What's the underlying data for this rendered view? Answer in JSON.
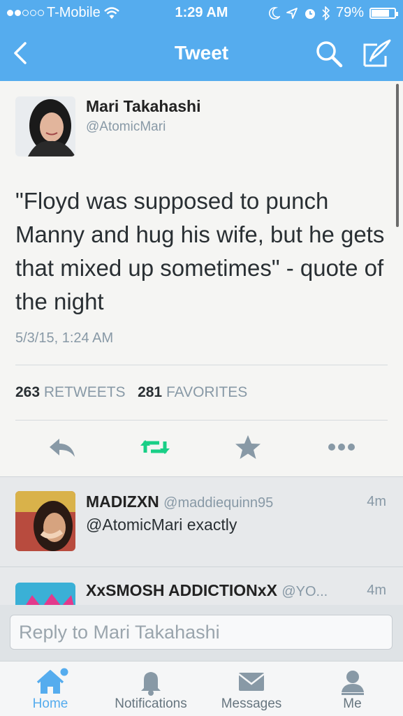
{
  "status_bar": {
    "carrier": "T-Mobile",
    "time": "1:29 AM",
    "battery": "79%",
    "battery_level": 0.79
  },
  "nav": {
    "title": "Tweet"
  },
  "tweet": {
    "author_name": "Mari Takahashi",
    "author_handle": "@AtomicMari",
    "text": "\"Floyd was supposed to punch Manny and hug his wife, but he gets that mixed up sometimes\" - quote of the night",
    "timestamp": "5/3/15, 1:24 AM",
    "retweets_count": "263",
    "retweets_label": "RETWEETS",
    "favorites_count": "281",
    "favorites_label": "FAVORITES"
  },
  "replies": [
    {
      "name": "MADIZXN",
      "handle": "@maddiequinn95",
      "age": "4m",
      "text": "@AtomicMari exactly"
    },
    {
      "name": "XxSMOSH ADDICTIONxX",
      "handle": "@YO...",
      "age": "4m",
      "text": ""
    }
  ],
  "reply_box": {
    "placeholder": "Reply to Mari Takahashi"
  },
  "tabs": [
    {
      "label": "Home",
      "icon": "home-icon",
      "active": true
    },
    {
      "label": "Notifications",
      "icon": "bell-icon",
      "active": false
    },
    {
      "label": "Messages",
      "icon": "envelope-icon",
      "active": false
    },
    {
      "label": "Me",
      "icon": "person-icon",
      "active": false
    }
  ],
  "colors": {
    "brand": "#55acee",
    "retweet_green": "#19cf86",
    "text_secondary": "#8899a6"
  }
}
